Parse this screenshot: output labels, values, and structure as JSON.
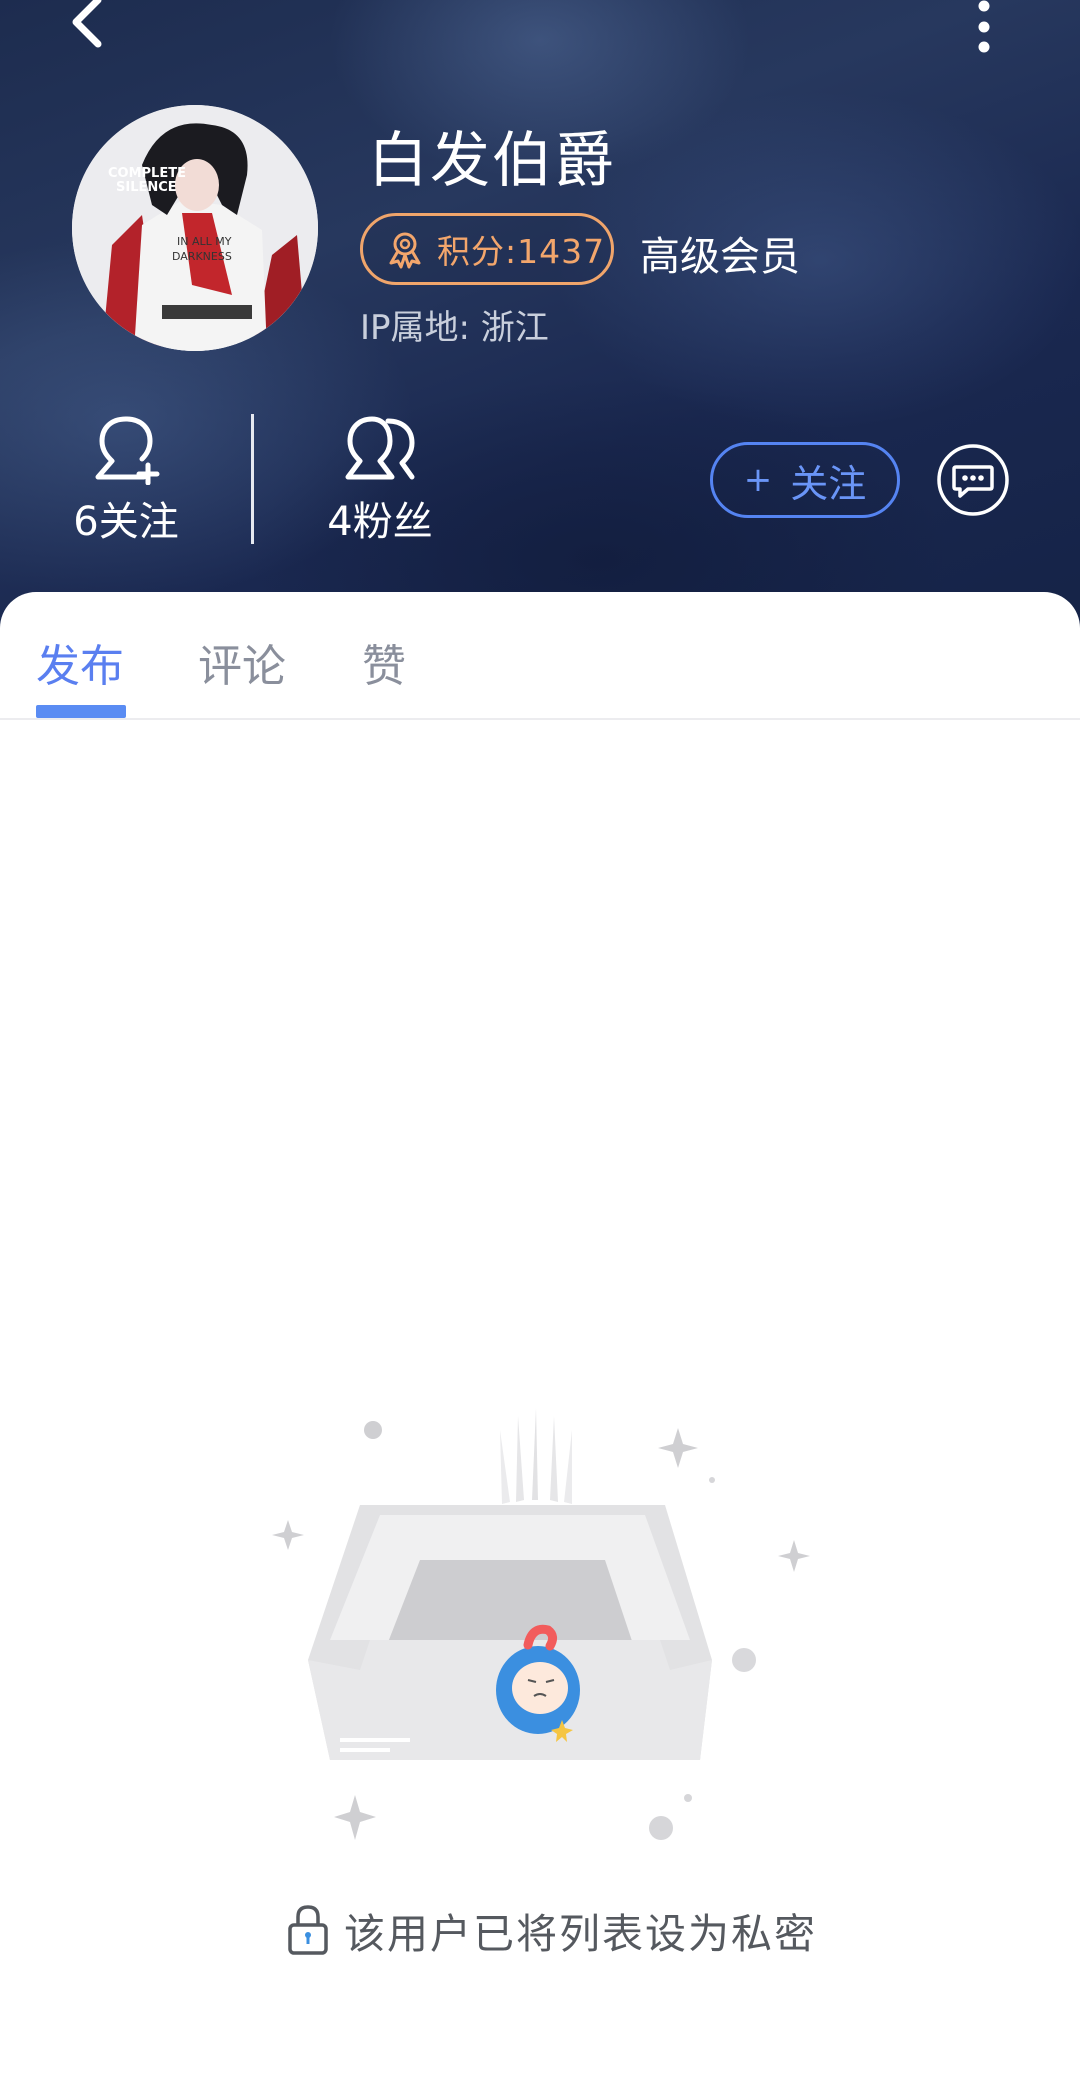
{
  "profile": {
    "username": "白发伯爵",
    "points_label": "积分:1437",
    "member_level": "高级会员",
    "ip_location": "IP属地: 浙江"
  },
  "stats": {
    "following": "6关注",
    "fans": "4粉丝"
  },
  "actions": {
    "follow_plus": "+",
    "follow_label": "关注"
  },
  "tabs": [
    {
      "label": "发布",
      "active": true
    },
    {
      "label": "评论",
      "active": false
    },
    {
      "label": "赞",
      "active": false
    }
  ],
  "empty_state": {
    "message": "该用户已将列表设为私密"
  },
  "colors": {
    "accent": "#5a7ff0",
    "points": "#f3a66c",
    "header_bg": "#1d2c4f"
  },
  "icons": {
    "back": "chevron-left-icon",
    "more": "more-vertical-icon",
    "medal": "medal-icon",
    "following": "person-add-icon",
    "fans": "people-icon",
    "chat": "chat-bubble-icon",
    "lock": "lock-icon"
  }
}
